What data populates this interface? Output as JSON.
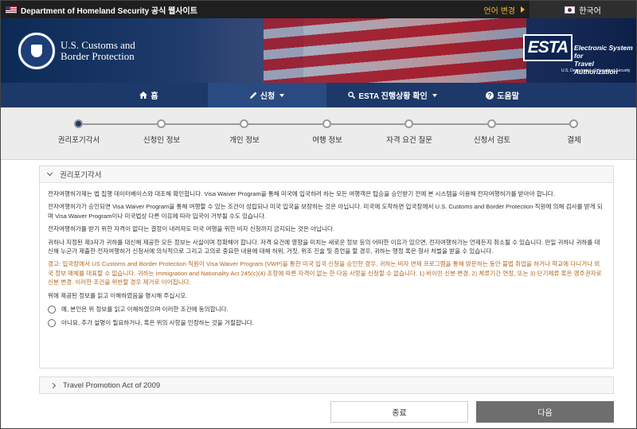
{
  "topbar": {
    "official_site": "Department of Homeland Security 공식 웹사이트",
    "change_language": "언어 변경",
    "current_language": "한국어"
  },
  "header": {
    "agency_line1": "U.S. Customs and",
    "agency_line2": "Border Protection",
    "esta_logo": "ESTA",
    "esta_full_line1": "Electronic System for",
    "esta_full_line2": "Travel Authorization",
    "esta_sub": "U.S. Department of Homeland Security"
  },
  "nav": {
    "home": "홈",
    "apply": "신청",
    "check_status": "ESTA 진행상황 확인",
    "help": "도움말"
  },
  "progress": {
    "steps": [
      "권리포기각서",
      "신청인 정보",
      "개인 정보",
      "여행 정보",
      "자격 요건 질문",
      "신청서 검토",
      "결제"
    ],
    "current_step": 1
  },
  "waiver_panel": {
    "title": "권리포기각서",
    "p1": "전자여행허가제는 법 집행 데이터베이스와 대조해 확인합니다. Visa Waiver Program을 통해 미국에 입국하려 하는 모든 여행객은 탑승을 승인받기 전에 본 시스템을 이용해 전자여행허가를 받아야 합니다.",
    "p2": "전자여행허가가 승인되면 Visa Waiver Program을 통해 여행할 수 있는 조건이 성립되나 미국 입국을 보장하는 것은 아닙니다. 미국에 도착하면 입국장에서 U.S. Customs and Border Protection 직원에 의해 검사를 받게 되며 Visa Waiver Program이나 미국법상 다른 이유에 따라 입국이 거부될 수도 있습니다.",
    "p3": "전자여행허가를 받기 위한 자격이 없다는 결정이 내려져도 미국 여행을 위한 비자 신청까지 금지되는 것은 아닙니다.",
    "p4": "귀하나 지정된 제3자가 귀하를 대신해 제공한 모든 정보는 사실이며 정확해야 합니다. 자격 요건에 영향을 미치는 새로운 정보 등의 어떠한 이유가 있으면, 전자여행허가는 언제든지 취소될 수 있습니다. 만일 귀하나 귀하를 대신해 누군가 제출한 전자여행허가 신청서에 의식적으로 그리고 고의로 중요한 내용에 대해 허위, 거짓, 위조 진술 및 증언을 할 경우, 귀하는 행정 혹은 형사 처벌을 받을 수 있습니다.",
    "warning": "경고: 입국장에서 US Customs and Border Protection 직원이 Visa Waiver Program (VWP)을 통한 미국 입국 신청을 승인한 경우, 귀하는 비자 면제 프로그램을 통해 방문하는 동안 불법 취업을 하거나 학교에 다니거나 외국 정보 매체를 대표할 수 없습니다. 귀하는 Immigration and Nationality Act 245(c)(4) 조항에 따른 자격이 없는 한 다음 사항을 신청할 수 없습니다. 1) 비이민 신분 변경, 2) 체류기간 연장, 또는 3) 단기체류 혹은 영주권자로 신분 변경. 이러한 조건을 위반할 경우 제거로 이어집니다.",
    "confirm_prompt": "위에 제공된 정보를 읽고 이해하였음을 명시해 주십시오.",
    "option_yes": "예, 본인은 위 정보를 읽고 이해하였으며 이러한 조건에 동의합니다.",
    "option_no": "아니요, 추가 설명이 필요하거나, 혹은 위의 사항을 인정하는 것을 거절합니다."
  },
  "travel_promotion_panel": {
    "title": "Travel Promotion Act of 2009"
  },
  "buttons": {
    "exit": "종료",
    "next": "다음"
  },
  "colors": {
    "nav_bg": "#1d3969",
    "warning_text": "#b5651d",
    "next_button": "#6e6e6e"
  }
}
